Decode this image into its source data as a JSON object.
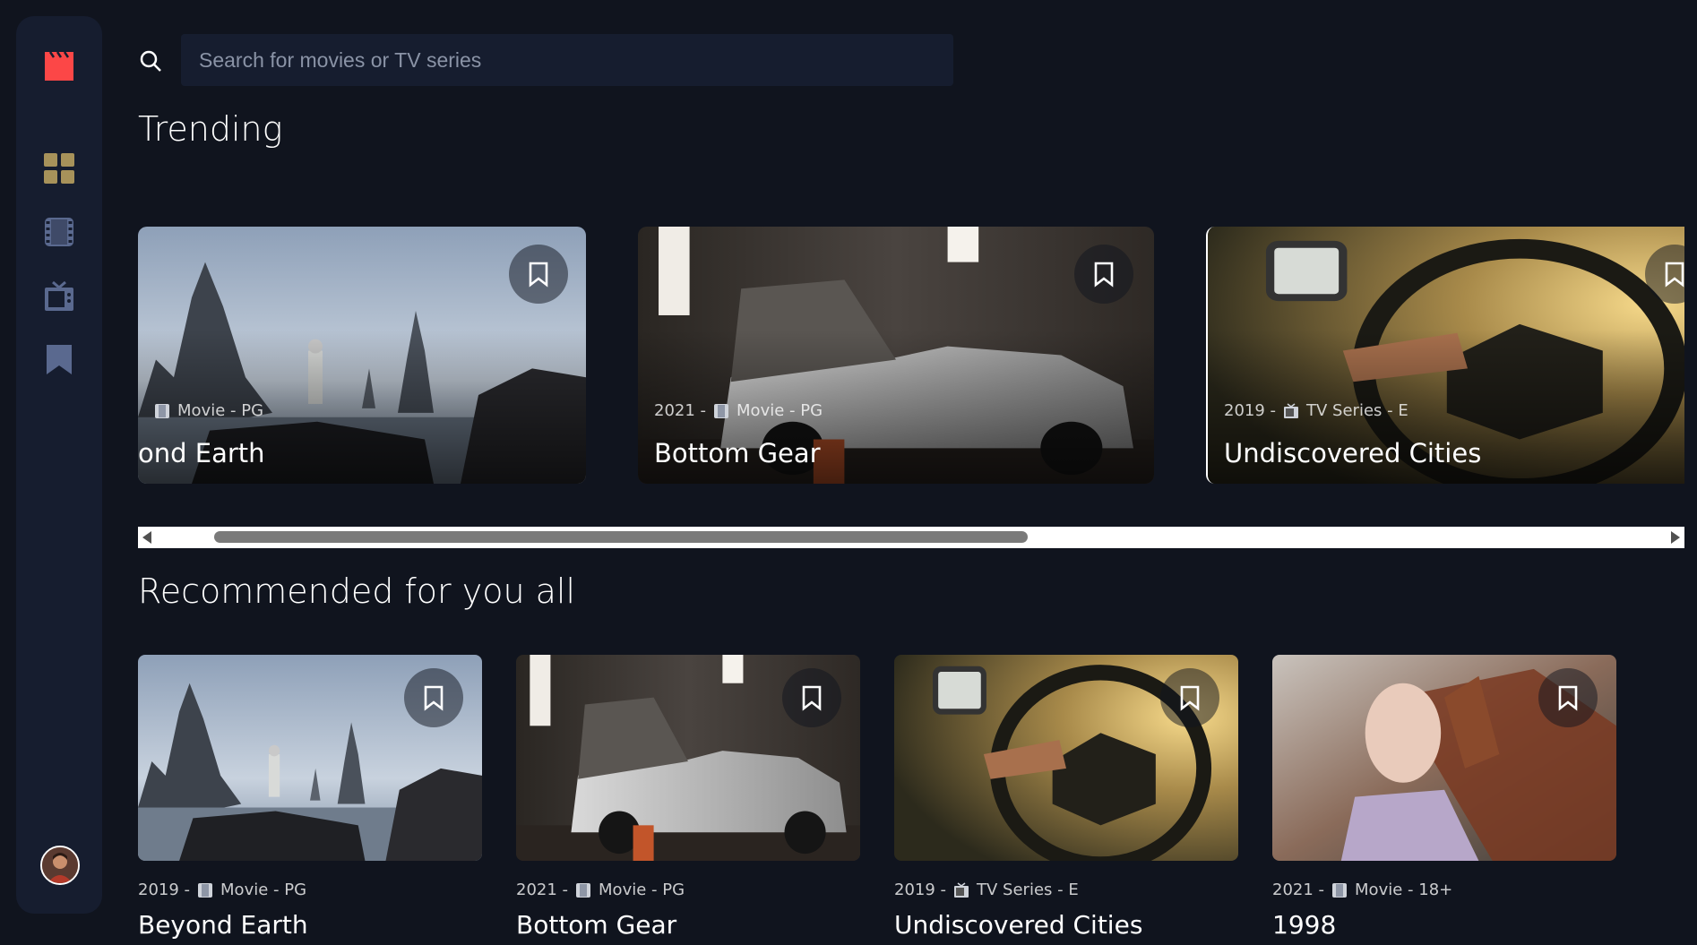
{
  "colors": {
    "background": "#10141E",
    "sidebar": "#161D2F",
    "accent": "#FC4747",
    "nav_active": "#FFFFFF",
    "nav_inactive": "#5A698F",
    "text_muted": "#B9BEC9"
  },
  "sidebar": {
    "logo_icon": "clapperboard-icon",
    "items": [
      {
        "icon": "home-grid-icon",
        "active": true
      },
      {
        "icon": "film-strip-icon",
        "active": false
      },
      {
        "icon": "tv-icon",
        "active": false
      },
      {
        "icon": "bookmark-icon",
        "active": false
      }
    ],
    "avatar_icon": "user-avatar"
  },
  "search": {
    "placeholder": "Search for movies or TV series",
    "value": ""
  },
  "trending": {
    "heading": "Trending",
    "items": [
      {
        "year": "",
        "category": "Movie",
        "rating": "PG",
        "meta": "Movie - PG",
        "title": "ond Earth",
        "image": "sea stacks landscape"
      },
      {
        "year": "2021 -",
        "category": "Movie",
        "rating": "PG",
        "meta": "Movie - PG",
        "title": "Bottom Gear",
        "image": "car in garage"
      },
      {
        "year": "2019 -",
        "category": "TV Series",
        "rating": "E",
        "meta": "TV Series - E",
        "title": "Undiscovered Cities",
        "image": "steering wheel"
      }
    ]
  },
  "recommended": {
    "heading": "Recommended for you all",
    "items": [
      {
        "year": "2019 -",
        "category": "Movie",
        "meta": "Movie - PG",
        "title": "Beyond Earth",
        "image": "sea stacks landscape"
      },
      {
        "year": "2021 -",
        "category": "Movie",
        "meta": "Movie - PG",
        "title": "Bottom Gear",
        "image": "car in garage"
      },
      {
        "year": "2019 -",
        "category": "TV Series",
        "meta": "TV Series - E",
        "title": "Undiscovered Cities",
        "image": "steering wheel"
      },
      {
        "year": "2021 -",
        "category": "Movie",
        "meta": "Movie - 18+",
        "title": "1998",
        "image": "woman with windblown hair"
      }
    ]
  }
}
